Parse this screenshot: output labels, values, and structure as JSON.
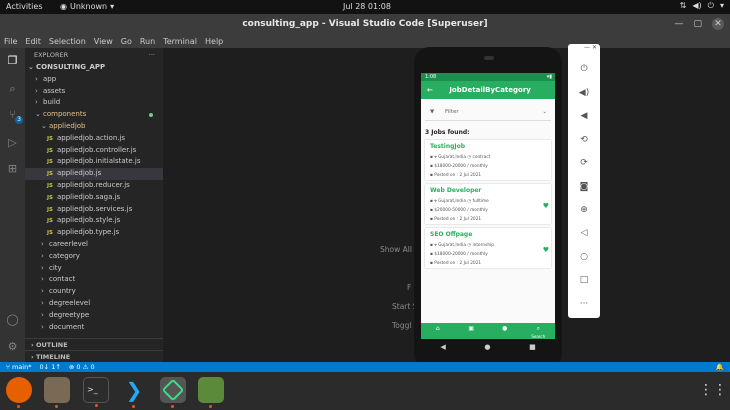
{
  "topbar": {
    "activities": "Activities",
    "app_name": "Unknown",
    "clock": "Jul 28  01:08"
  },
  "window": {
    "title": "consulting_app - Visual Studio Code [Superuser]"
  },
  "menu": [
    "File",
    "Edit",
    "Selection",
    "View",
    "Go",
    "Run",
    "Terminal",
    "Help"
  ],
  "explorer": {
    "header": "EXPLORER",
    "project": "CONSULTING_APP",
    "tree": [
      {
        "label": "app",
        "type": "folder",
        "depth": 1
      },
      {
        "label": "assets",
        "type": "folder",
        "depth": 1
      },
      {
        "label": "build",
        "type": "folder",
        "depth": 1
      },
      {
        "label": "components",
        "type": "folder-open",
        "depth": 1
      },
      {
        "label": "appliedjob",
        "type": "folder-open",
        "depth": 2
      },
      {
        "label": "appliedjob.action.js",
        "type": "file",
        "depth": 3
      },
      {
        "label": "appliedjob.controller.js",
        "type": "file",
        "depth": 3
      },
      {
        "label": "appliedjob.initialstate.js",
        "type": "file",
        "depth": 3
      },
      {
        "label": "appliedjob.js",
        "type": "file",
        "depth": 3,
        "selected": true
      },
      {
        "label": "appliedjob.reducer.js",
        "type": "file",
        "depth": 3
      },
      {
        "label": "appliedjob.saga.js",
        "type": "file",
        "depth": 3
      },
      {
        "label": "appliedjob.services.js",
        "type": "file",
        "depth": 3
      },
      {
        "label": "appliedjob.style.js",
        "type": "file",
        "depth": 3
      },
      {
        "label": "appliedjob.type.js",
        "type": "file",
        "depth": 3
      },
      {
        "label": "careerlevel",
        "type": "folder",
        "depth": 2
      },
      {
        "label": "category",
        "type": "folder",
        "depth": 2
      },
      {
        "label": "city",
        "type": "folder",
        "depth": 2
      },
      {
        "label": "contact",
        "type": "folder",
        "depth": 2
      },
      {
        "label": "country",
        "type": "folder",
        "depth": 2
      },
      {
        "label": "degreelevel",
        "type": "folder",
        "depth": 2
      },
      {
        "label": "degreetype",
        "type": "folder",
        "depth": 2
      },
      {
        "label": "document",
        "type": "folder",
        "depth": 2
      }
    ],
    "outline": "OUTLINE",
    "timeline": "TIMELINE"
  },
  "editor_hints": {
    "show_all": "Show All C",
    "f": "F",
    "start": "Start S",
    "toggle": "Toggl"
  },
  "status": {
    "branch": "main*",
    "sync": "0↓ 1↑",
    "errors": "⊗ 0 ⚠ 0"
  },
  "phone": {
    "statusbar_time": "1:08",
    "appbar_title": "JobDetailByCategory",
    "filter_label": "Filter",
    "jobs_found": "3 Jobs found:",
    "jobs": [
      {
        "title": "TestingJob",
        "location": "Gujarat,India",
        "job_type": "contract",
        "salary": "$18000-20000 / monthly",
        "posted": "Posted on : 2 Jul 2021",
        "favorite": false
      },
      {
        "title": "Web Developer",
        "location": "Gujarat,India",
        "job_type": "fulltime",
        "salary": "$20000-50000 / monthly",
        "posted": "Posted on : 2 Jul 2021",
        "favorite": true
      },
      {
        "title": "SEO Offpage",
        "location": "Gujarat,India",
        "job_type": "internship",
        "salary": "$18000-20000 / monthly",
        "posted": "Posted on : 2 Jul 2021",
        "favorite": true
      }
    ],
    "bottom_nav": [
      "home",
      "jobs",
      "profile",
      "Search"
    ]
  }
}
